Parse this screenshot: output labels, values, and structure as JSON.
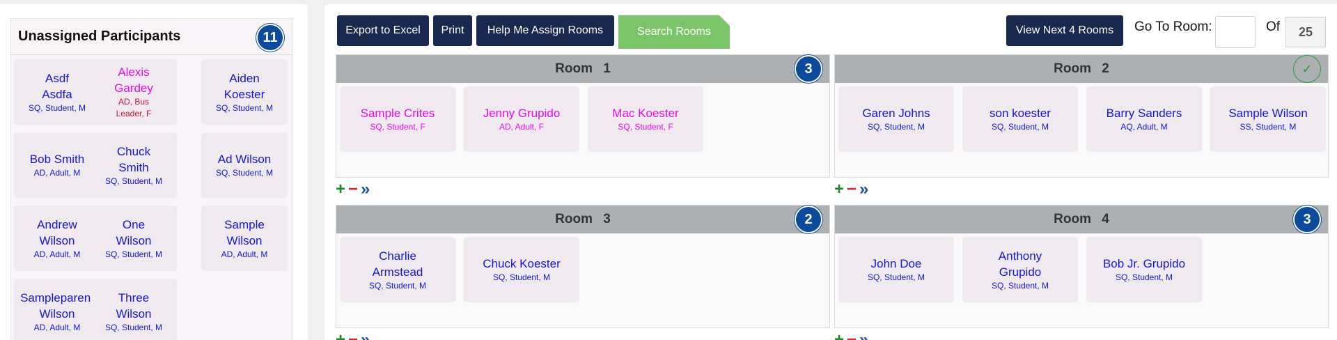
{
  "unassigned": {
    "title": "Unassigned Participants",
    "count": "11",
    "participants": [
      {
        "name": "Asdf Asdfa",
        "meta": "SQ, Student, M",
        "color": "blue"
      },
      {
        "name": "Alexis Gardey",
        "meta": "AD, Bus Leader, F",
        "color": "mixed"
      },
      {
        "name": "Aiden Koester",
        "meta": "SQ, Student, M",
        "color": "blue"
      },
      {
        "name": "Bob Smith",
        "meta": "AD, Adult, M",
        "color": "blue"
      },
      {
        "name": "Chuck Smith",
        "meta": "SQ, Student, M",
        "color": "blue"
      },
      {
        "name": "Ad Wilson",
        "meta": "SQ, Student, M",
        "color": "blue"
      },
      {
        "name": "Andrew Wilson",
        "meta": "AD, Adult, M",
        "color": "blue"
      },
      {
        "name": "One Wilson",
        "meta": "SQ, Student, M",
        "color": "blue"
      },
      {
        "name": "Sample Wilson",
        "meta": "AD, Adult, M",
        "color": "blue"
      },
      {
        "name": "Sampleparent Wilson",
        "meta": "AD, Adult, M",
        "color": "blue"
      },
      {
        "name": "Three Wilson",
        "meta": "SQ, Student, M",
        "color": "blue"
      }
    ]
  },
  "toolbar": {
    "export_label": "Export to Excel",
    "print_label": "Print",
    "help_label": "Help Me Assign Rooms",
    "search_label": "Search Rooms",
    "view_next_label": "View Next 4 Rooms",
    "goto_label": "Go To Room:",
    "goto_value": "",
    "of_label": "Of",
    "total_rooms": "25"
  },
  "rooms": [
    {
      "title": "Room 1",
      "count": "3",
      "members": [
        {
          "name": "Sample Crites",
          "meta": "SQ, Student, F",
          "color": "pink"
        },
        {
          "name": "Jenny Grupido",
          "meta": "AD, Adult, F",
          "color": "pink"
        },
        {
          "name": "Mac Koester",
          "meta": "SQ, Student, F",
          "color": "pink"
        }
      ]
    },
    {
      "title": "Room 2",
      "count": "",
      "status_icon": "check-icon",
      "members": [
        {
          "name": "Garen Johns",
          "meta": "SQ, Student, M",
          "color": "blue"
        },
        {
          "name": "son koester",
          "meta": "SQ, Student, M",
          "color": "blue"
        },
        {
          "name": "Barry Sanders",
          "meta": "AQ, Adult, M",
          "color": "blue"
        },
        {
          "name": "Sample Wilson",
          "meta": "SS, Student, M",
          "color": "blue"
        }
      ]
    },
    {
      "title": "Room 3",
      "count": "2",
      "members": [
        {
          "name": "Charlie Armstead",
          "meta": "SQ, Student, M",
          "color": "blue"
        },
        {
          "name": "Chuck Koester",
          "meta": "SQ, Student, M",
          "color": "blue"
        }
      ]
    },
    {
      "title": "Room 4",
      "count": "3",
      "members": [
        {
          "name": "John Doe",
          "meta": "SQ, Student, M",
          "color": "blue"
        },
        {
          "name": "Anthony Grupido",
          "meta": "SQ, Student, M",
          "color": "blue"
        },
        {
          "name": "Bob Jr. Grupido",
          "meta": "SQ, Student, M",
          "color": "blue"
        }
      ]
    }
  ],
  "room_controls": {
    "add": "+",
    "remove": "−",
    "more": "»"
  },
  "colors": {
    "navy_button": "#18294d",
    "badge_blue": "#0c4a9e",
    "search_green": "#7cc46a",
    "participant_blue": "#1515d8",
    "participant_pink": "#e40ee4",
    "leader_red": "#c0123c",
    "room_header_gray": "#acb0b3"
  }
}
